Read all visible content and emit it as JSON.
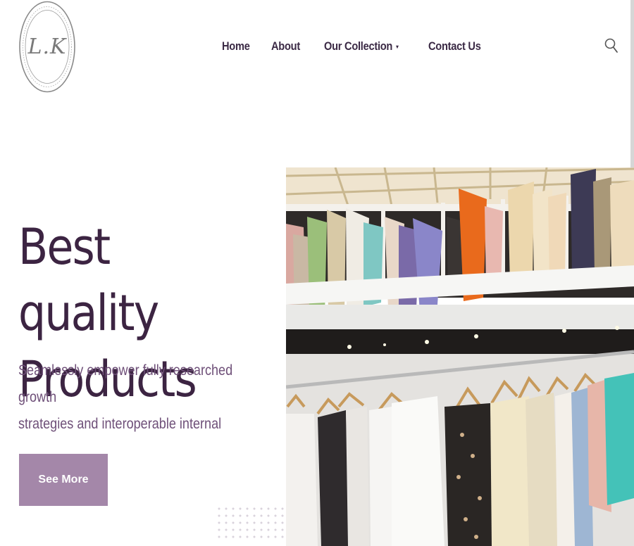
{
  "brand": {
    "logo_text": "L.K"
  },
  "nav": {
    "items": [
      {
        "label": "Home"
      },
      {
        "label": "About"
      },
      {
        "label": "Our Collection",
        "has_dropdown": true
      },
      {
        "label": "Contact Us"
      }
    ],
    "dropdown_caret": "▾"
  },
  "hero": {
    "title_line1": "Best quality",
    "title_line2": "Products",
    "subtitle_line1": "Seamlessly empower fully researched growth",
    "subtitle_line2": "strategies and interoperable internal",
    "cta_label": "See More"
  },
  "colors": {
    "heading": "#3c2442",
    "subtitle": "#6e4f78",
    "button_bg": "#a487a9",
    "nav_text": "#3b2a45"
  },
  "icons": {
    "search": "search-icon",
    "caret": "chevron-down-icon"
  }
}
